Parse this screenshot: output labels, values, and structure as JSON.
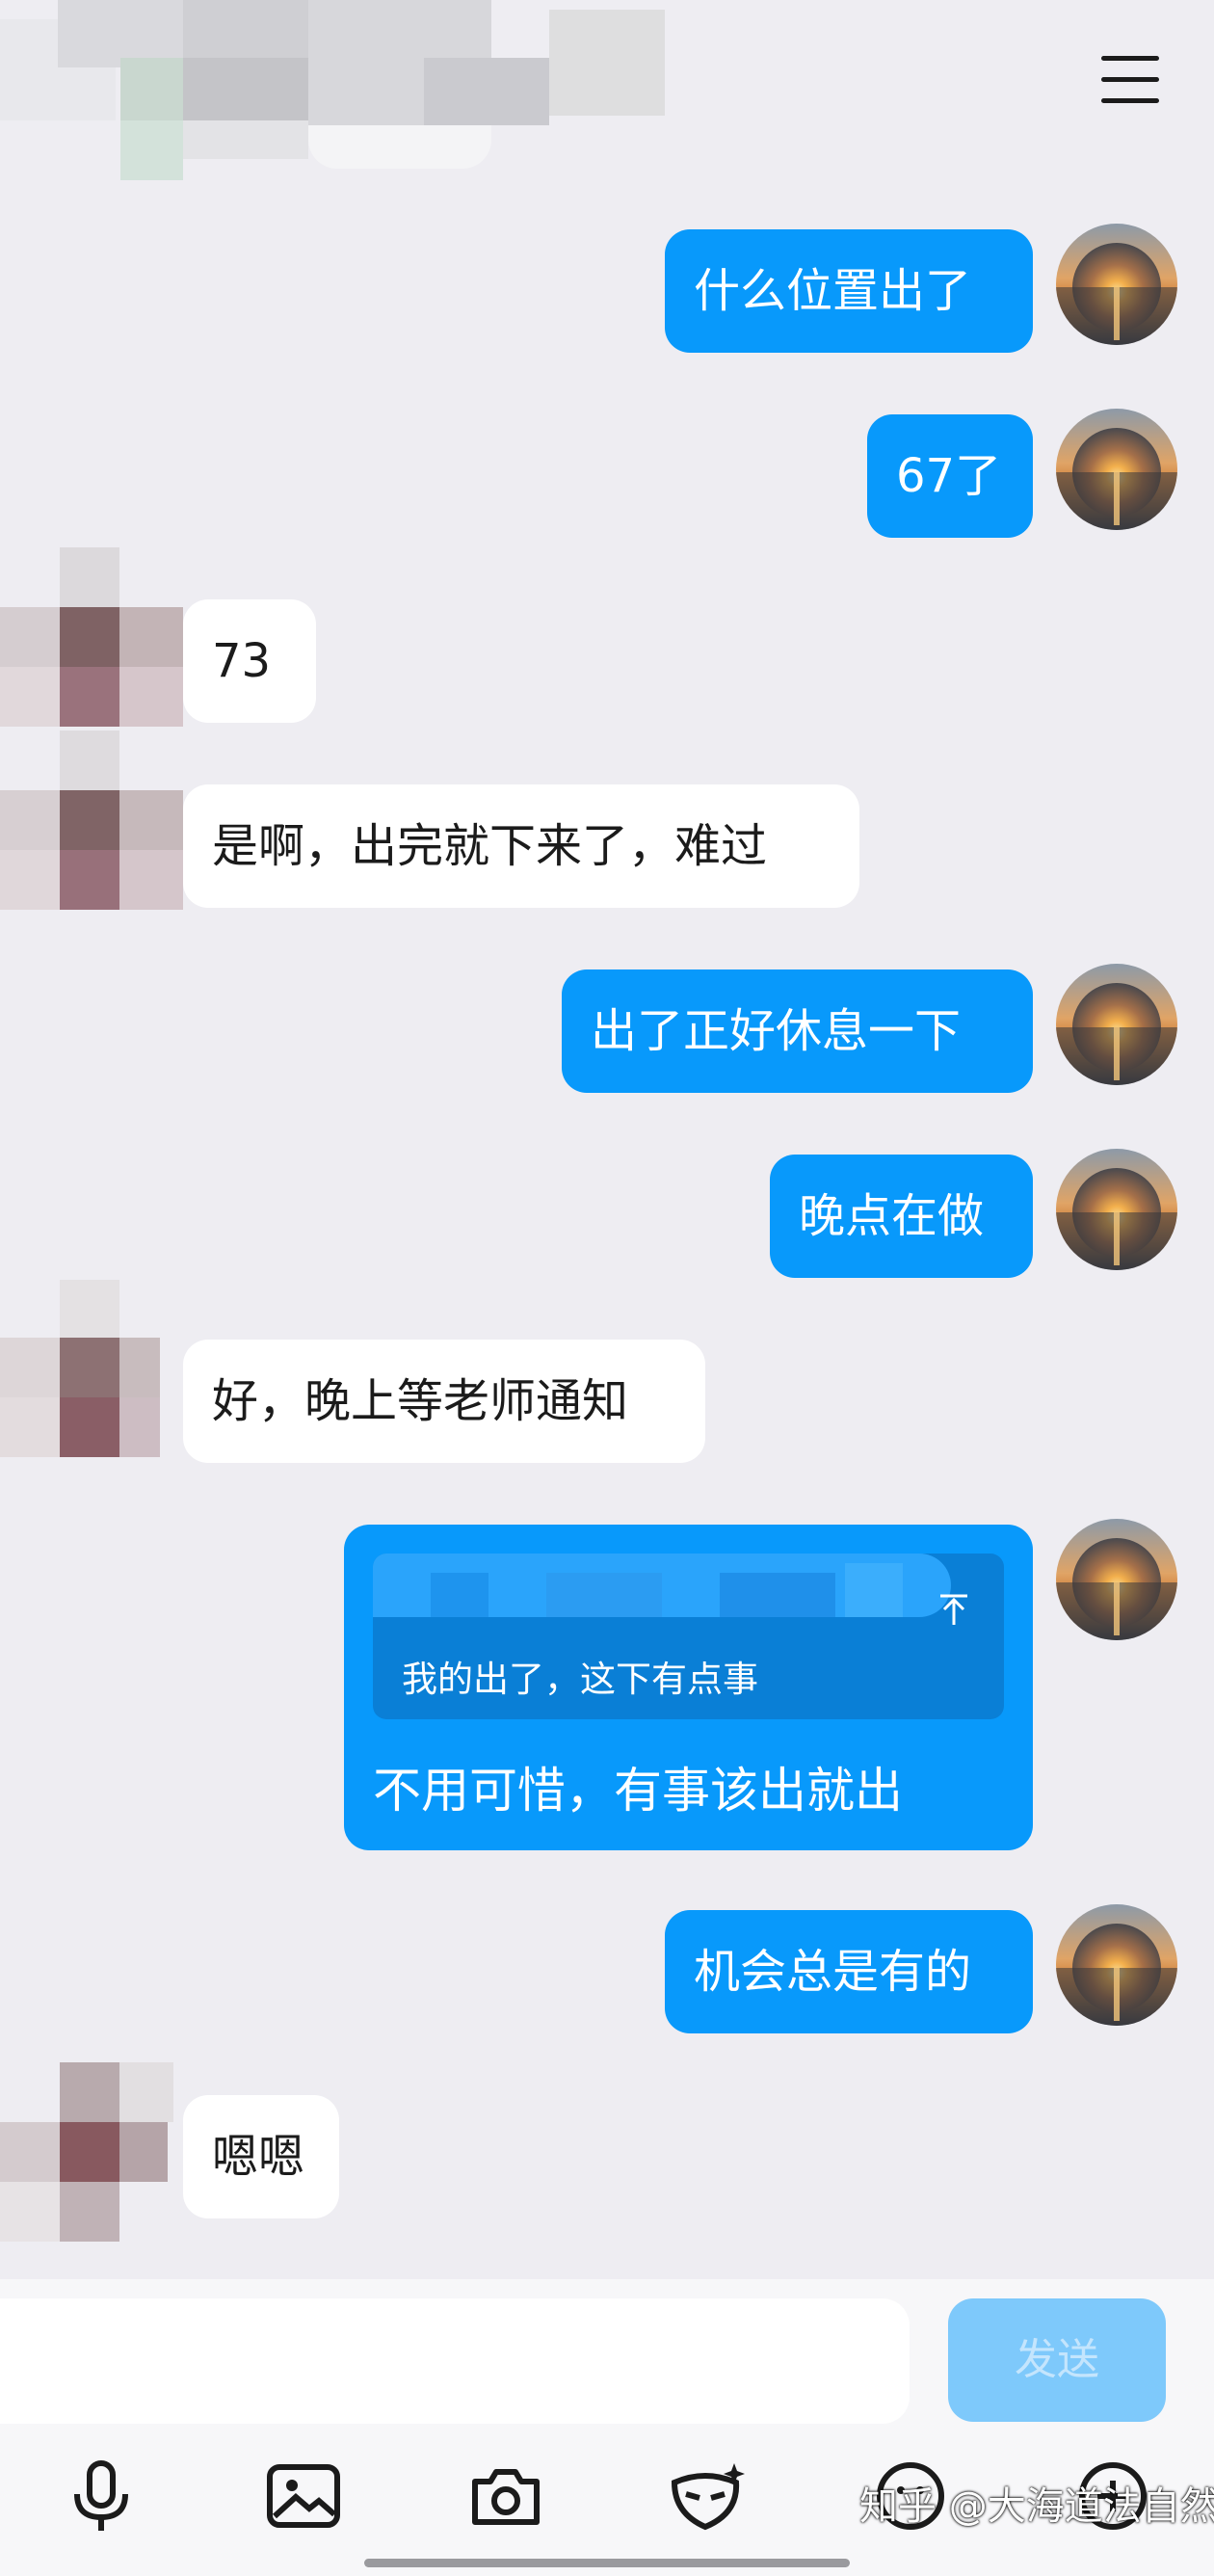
{
  "header": {
    "menu_icon": "menu-icon"
  },
  "messages": [
    {
      "side": "mine",
      "text": "什么位置出了"
    },
    {
      "side": "mine",
      "text": "67了"
    },
    {
      "side": "theirs",
      "text": "73"
    },
    {
      "side": "theirs",
      "text": "是啊，出完就下来了，难过"
    },
    {
      "side": "mine",
      "text": "出了正好休息一下"
    },
    {
      "side": "mine",
      "text": "晚点在做"
    },
    {
      "side": "theirs",
      "text": "好，晚上等老师通知"
    },
    {
      "side": "mine",
      "quote": "我的出了，这下有点事",
      "text": "不用可惜，有事该出就出"
    },
    {
      "side": "mine",
      "text": "机会总是有的"
    },
    {
      "side": "theirs",
      "text": "嗯嗯"
    }
  ],
  "composer": {
    "send_label": "发送",
    "tools": [
      "microphone-icon",
      "image-icon",
      "camera-icon",
      "mask-icon",
      "emoji-icon",
      "plus-icon"
    ]
  },
  "watermark": "知乎 @大海道法自然",
  "colors": {
    "accent": "#0899fb",
    "background": "#eeedf2",
    "send_disabled": "#7ec9fb"
  }
}
